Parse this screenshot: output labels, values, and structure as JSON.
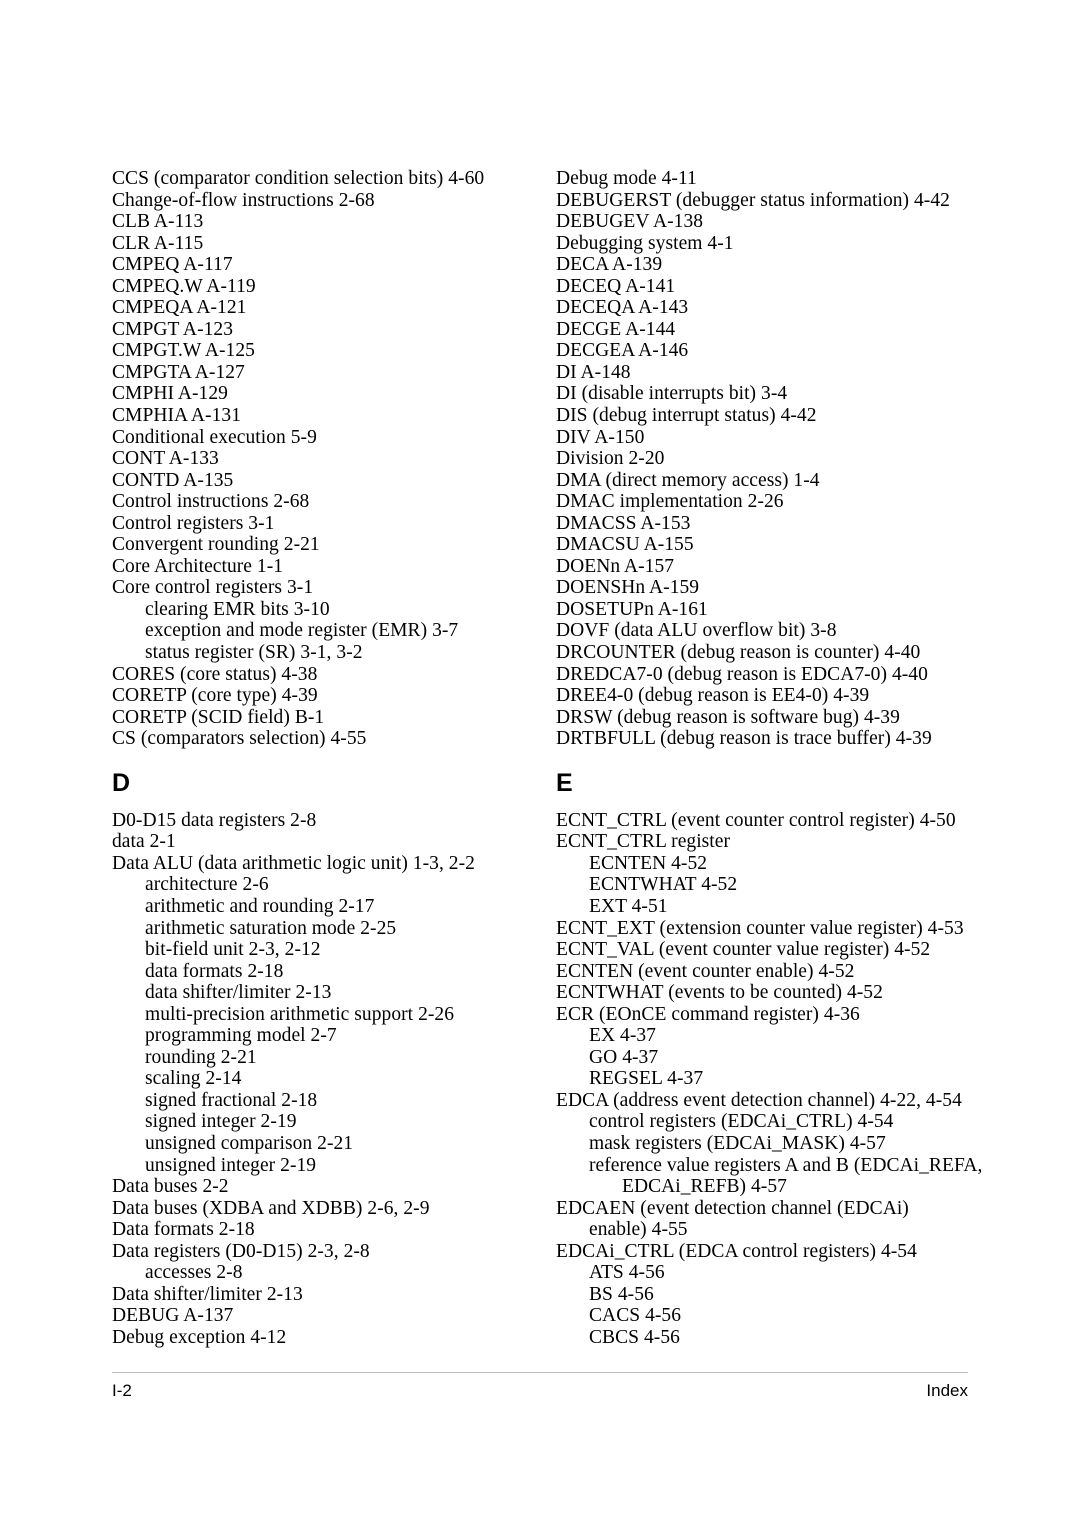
{
  "page": {
    "footer_left": "I-2",
    "footer_right": "Index",
    "rule_color": "#bdbdbd",
    "background": "#ffffff",
    "text_color": "#000000"
  },
  "columns": {
    "left": {
      "pre_section_entries": [
        {
          "level": 0,
          "text": "CCS (comparator condition selection bits) 4-60"
        },
        {
          "level": 0,
          "text": "Change-of-flow instructions 2-68"
        },
        {
          "level": 0,
          "text": "CLB A-113"
        },
        {
          "level": 0,
          "text": "CLR A-115"
        },
        {
          "level": 0,
          "text": "CMPEQ A-117"
        },
        {
          "level": 0,
          "text": "CMPEQ.W A-119"
        },
        {
          "level": 0,
          "text": "CMPEQA A-121"
        },
        {
          "level": 0,
          "text": "CMPGT A-123"
        },
        {
          "level": 0,
          "text": "CMPGT.W A-125"
        },
        {
          "level": 0,
          "text": "CMPGTA A-127"
        },
        {
          "level": 0,
          "text": "CMPHI A-129"
        },
        {
          "level": 0,
          "text": "CMPHIA A-131"
        },
        {
          "level": 0,
          "text": "Conditional execution 5-9"
        },
        {
          "level": 0,
          "text": "CONT A-133"
        },
        {
          "level": 0,
          "text": "CONTD A-135"
        },
        {
          "level": 0,
          "text": "Control instructions 2-68"
        },
        {
          "level": 0,
          "text": "Control registers 3-1"
        },
        {
          "level": 0,
          "text": "Convergent rounding 2-21"
        },
        {
          "level": 0,
          "text": "Core Architecture 1-1"
        },
        {
          "level": 0,
          "text": "Core control registers 3-1"
        },
        {
          "level": 1,
          "text": "clearing EMR bits 3-10"
        },
        {
          "level": 1,
          "text": "exception and mode register (EMR) 3-7"
        },
        {
          "level": 1,
          "text": "status register (SR) 3-1, 3-2"
        },
        {
          "level": 0,
          "text": "CORES (core status) 4-38"
        },
        {
          "level": 0,
          "text": "CORETP (core type) 4-39"
        },
        {
          "level": 0,
          "text": "CORETP (SCID field) B-1"
        },
        {
          "level": 0,
          "text": "CS (comparators selection) 4-55"
        }
      ],
      "section_letter": "D",
      "post_section_entries": [
        {
          "level": 0,
          "text": "D0-D15 data registers 2-8"
        },
        {
          "level": 0,
          "text": "data 2-1"
        },
        {
          "level": 0,
          "text": "Data ALU (data arithmetic logic unit) 1-3, 2-2"
        },
        {
          "level": 1,
          "text": "architecture 2-6"
        },
        {
          "level": 1,
          "text": "arithmetic and rounding 2-17"
        },
        {
          "level": 1,
          "text": "arithmetic saturation mode 2-25"
        },
        {
          "level": 1,
          "text": "bit-field unit 2-3, 2-12"
        },
        {
          "level": 1,
          "text": "data formats 2-18"
        },
        {
          "level": 1,
          "text": "data shifter/limiter 2-13"
        },
        {
          "level": 1,
          "text": "multi-precision arithmetic support 2-26"
        },
        {
          "level": 1,
          "text": "programming model 2-7"
        },
        {
          "level": 1,
          "text": "rounding 2-21"
        },
        {
          "level": 1,
          "text": "scaling 2-14"
        },
        {
          "level": 1,
          "text": "signed fractional 2-18"
        },
        {
          "level": 1,
          "text": "signed integer 2-19"
        },
        {
          "level": 1,
          "text": "unsigned comparison 2-21"
        },
        {
          "level": 1,
          "text": "unsigned integer 2-19"
        },
        {
          "level": 0,
          "text": "Data buses 2-2"
        },
        {
          "level": 0,
          "text": "Data buses (XDBA and XDBB) 2-6, 2-9"
        },
        {
          "level": 0,
          "text": "Data formats 2-18"
        },
        {
          "level": 0,
          "text": "Data registers (D0-D15) 2-3, 2-8"
        },
        {
          "level": 1,
          "text": "accesses 2-8"
        },
        {
          "level": 0,
          "text": "Data shifter/limiter 2-13"
        },
        {
          "level": 0,
          "text": "DEBUG A-137"
        },
        {
          "level": 0,
          "text": "Debug exception 4-12"
        }
      ]
    },
    "right": {
      "pre_section_entries": [
        {
          "level": 0,
          "text": "Debug mode 4-11"
        },
        {
          "level": 0,
          "text": "DEBUGERST (debugger status information) 4-42"
        },
        {
          "level": 0,
          "text": "DEBUGEV A-138"
        },
        {
          "level": 0,
          "text": "Debugging system 4-1"
        },
        {
          "level": 0,
          "text": "DECA A-139"
        },
        {
          "level": 0,
          "text": "DECEQ A-141"
        },
        {
          "level": 0,
          "text": "DECEQA A-143"
        },
        {
          "level": 0,
          "text": "DECGE A-144"
        },
        {
          "level": 0,
          "text": "DECGEA A-146"
        },
        {
          "level": 0,
          "text": "DI A-148"
        },
        {
          "level": 0,
          "text": "DI (disable interrupts bit) 3-4"
        },
        {
          "level": 0,
          "text": "DIS (debug interrupt status) 4-42"
        },
        {
          "level": 0,
          "text": "DIV A-150"
        },
        {
          "level": 0,
          "text": "Division 2-20"
        },
        {
          "level": 0,
          "text": "DMA (direct memory access) 1-4"
        },
        {
          "level": 0,
          "text": "DMAC implementation 2-26"
        },
        {
          "level": 0,
          "text": "DMACSS A-153"
        },
        {
          "level": 0,
          "text": "DMACSU A-155"
        },
        {
          "level": 0,
          "text": "DOENn A-157"
        },
        {
          "level": 0,
          "text": "DOENSHn A-159"
        },
        {
          "level": 0,
          "text": "DOSETUPn A-161"
        },
        {
          "level": 0,
          "text": "DOVF (data ALU overflow bit) 3-8"
        },
        {
          "level": 0,
          "text": "DRCOUNTER (debug reason is counter) 4-40"
        },
        {
          "level": 0,
          "text": "DREDCA7-0 (debug reason is EDCA7-0) 4-40"
        },
        {
          "level": 0,
          "text": "DREE4-0 (debug reason is EE4-0) 4-39"
        },
        {
          "level": 0,
          "text": "DRSW (debug reason is software bug) 4-39"
        },
        {
          "level": 0,
          "text": "DRTBFULL (debug reason is trace buffer) 4-39"
        }
      ],
      "section_letter": "E",
      "post_section_entries": [
        {
          "level": 0,
          "text": "ECNT_CTRL (event counter control register) 4-50"
        },
        {
          "level": 0,
          "text": "ECNT_CTRL register"
        },
        {
          "level": 1,
          "text": "ECNTEN 4-52"
        },
        {
          "level": 1,
          "text": "ECNTWHAT 4-52"
        },
        {
          "level": 1,
          "text": "EXT 4-51"
        },
        {
          "level": 0,
          "text": "ECNT_EXT (extension counter value register) 4-53"
        },
        {
          "level": 0,
          "text": "ECNT_VAL (event counter value register) 4-52"
        },
        {
          "level": 0,
          "text": "ECNTEN (event counter enable) 4-52"
        },
        {
          "level": 0,
          "text": "ECNTWHAT (events to be counted) 4-52"
        },
        {
          "level": 0,
          "text": "ECR (EOnCE command register) 4-36"
        },
        {
          "level": 1,
          "text": "EX 4-37"
        },
        {
          "level": 1,
          "text": "GO 4-37"
        },
        {
          "level": 1,
          "text": "REGSEL 4-37"
        },
        {
          "level": 0,
          "text": "EDCA (address event detection channel) 4-22, 4-54"
        },
        {
          "level": 1,
          "text": "control registers (EDCAi_CTRL) 4-54"
        },
        {
          "level": 1,
          "text": "mask registers (EDCAi_MASK) 4-57"
        },
        {
          "level": 1,
          "text": "reference value registers A and B (EDCAi_REFA,"
        },
        {
          "level": 2,
          "text": "EDCAi_REFB) 4-57"
        },
        {
          "level": 0,
          "text": "EDCAEN (event detection channel (EDCAi)"
        },
        {
          "level": 1,
          "text": "enable) 4-55"
        },
        {
          "level": 0,
          "text": "EDCAi_CTRL (EDCA control registers) 4-54"
        },
        {
          "level": 1,
          "text": "ATS 4-56"
        },
        {
          "level": 1,
          "text": "BS 4-56"
        },
        {
          "level": 1,
          "text": "CACS 4-56"
        },
        {
          "level": 1,
          "text": "CBCS 4-56"
        }
      ]
    }
  }
}
